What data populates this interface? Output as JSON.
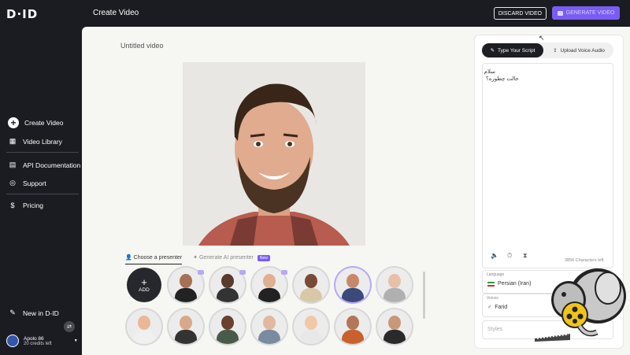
{
  "app": {
    "logo": "D·ID",
    "page_title": "Create Video"
  },
  "header": {
    "discard_label": "DISCARD VIDEO",
    "generate_label": "GENERATE VIDEO"
  },
  "sidebar": {
    "items": [
      {
        "label": "Create Video",
        "icon": "plus-circle-icon"
      },
      {
        "label": "Video Library",
        "icon": "grid-icon"
      },
      {
        "label": "API Documentation",
        "icon": "document-icon"
      },
      {
        "label": "Support",
        "icon": "lifebuoy-icon"
      },
      {
        "label": "Pricing",
        "icon": "dollar-icon"
      }
    ],
    "news_label": "New in D-ID",
    "user": {
      "name": "Apolo 86",
      "credits": "20 credits left"
    }
  },
  "main": {
    "video_title": "Untitled video",
    "tabs": [
      {
        "label": "Choose a presenter"
      },
      {
        "label": "Generate AI presenter",
        "badge": "New"
      }
    ],
    "add_label": "ADD"
  },
  "script_panel": {
    "tab_script": "Type Your Script",
    "tab_audio": "Upload Voice Audio",
    "script_line1": "سلام",
    "script_line2": "حالت چطوره؟",
    "chars_left": "3856 Characters left",
    "language_label": "Language",
    "language_value": "Persian (Iran)",
    "voices_label": "Voices",
    "voice_value": "Farid",
    "styles_placeholder": "Styles"
  }
}
